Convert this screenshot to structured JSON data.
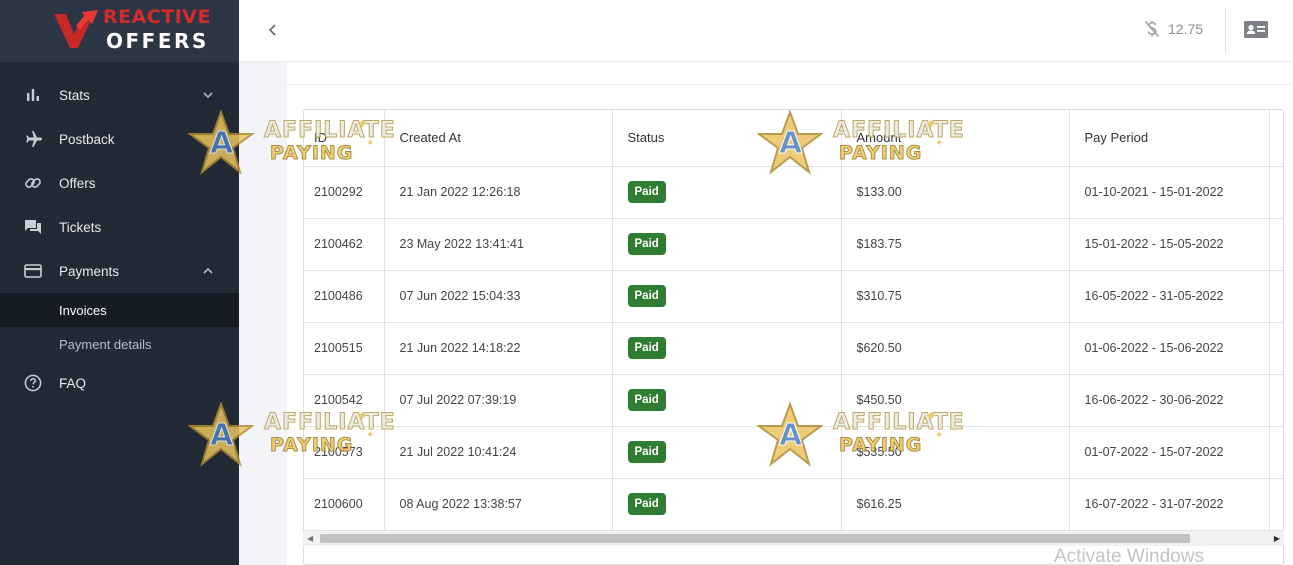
{
  "brand": {
    "top": "REACTIVE",
    "bottom": "OFFERS"
  },
  "sidebar": {
    "items": [
      {
        "label": "Stats",
        "icon": "bar-chart-icon"
      },
      {
        "label": "Postback",
        "icon": "airplane-icon"
      },
      {
        "label": "Offers",
        "icon": "link-icon"
      },
      {
        "label": "Tickets",
        "icon": "chat-icon"
      },
      {
        "label": "Payments",
        "icon": "credit-card-icon"
      }
    ],
    "sub_items": [
      {
        "label": "Invoices",
        "active": true
      },
      {
        "label": "Payment details",
        "active": false
      }
    ],
    "faq": {
      "label": "FAQ",
      "icon": "help-circle-icon"
    }
  },
  "header": {
    "balance": "12.75",
    "balance_icon": "money-off-icon",
    "profile_icon": "id-card-icon"
  },
  "table": {
    "columns": [
      "ID",
      "Created At",
      "Status",
      "Amount",
      "Pay Period"
    ],
    "rows": [
      {
        "id": "2100292",
        "created_at": "21 Jan 2022 12:26:18",
        "status": "Paid",
        "amount": "$133.00",
        "pay_period": "01-10-2021 - 15-01-2022"
      },
      {
        "id": "2100462",
        "created_at": "23 May 2022 13:41:41",
        "status": "Paid",
        "amount": "$183.75",
        "pay_period": "15-01-2022 - 15-05-2022"
      },
      {
        "id": "2100486",
        "created_at": "07 Jun 2022 15:04:33",
        "status": "Paid",
        "amount": "$310.75",
        "pay_period": "16-05-2022 - 31-05-2022"
      },
      {
        "id": "2100515",
        "created_at": "21 Jun 2022 14:18:22",
        "status": "Paid",
        "amount": "$620.50",
        "pay_period": "01-06-2022 - 15-06-2022"
      },
      {
        "id": "2100542",
        "created_at": "07 Jul 2022 07:39:19",
        "status": "Paid",
        "amount": "$450.50",
        "pay_period": "16-06-2022 - 30-06-2022"
      },
      {
        "id": "2100573",
        "created_at": "21 Jul 2022 10:41:24",
        "status": "Paid",
        "amount": "$535.50",
        "pay_period": "01-07-2022 - 15-07-2022"
      },
      {
        "id": "2100600",
        "created_at": "08 Aug 2022 13:38:57",
        "status": "Paid",
        "amount": "$616.25",
        "pay_period": "16-07-2022 - 31-07-2022"
      }
    ]
  },
  "colors": {
    "sidebar_bg": "#222a36",
    "paid_badge": "#2e7d32",
    "brand_red": "#d62b2b"
  },
  "watermark": {
    "line1": "AFFILIATE",
    "line2": "PAYING",
    "letter": "A"
  },
  "windows_watermark": "Activate Windows"
}
